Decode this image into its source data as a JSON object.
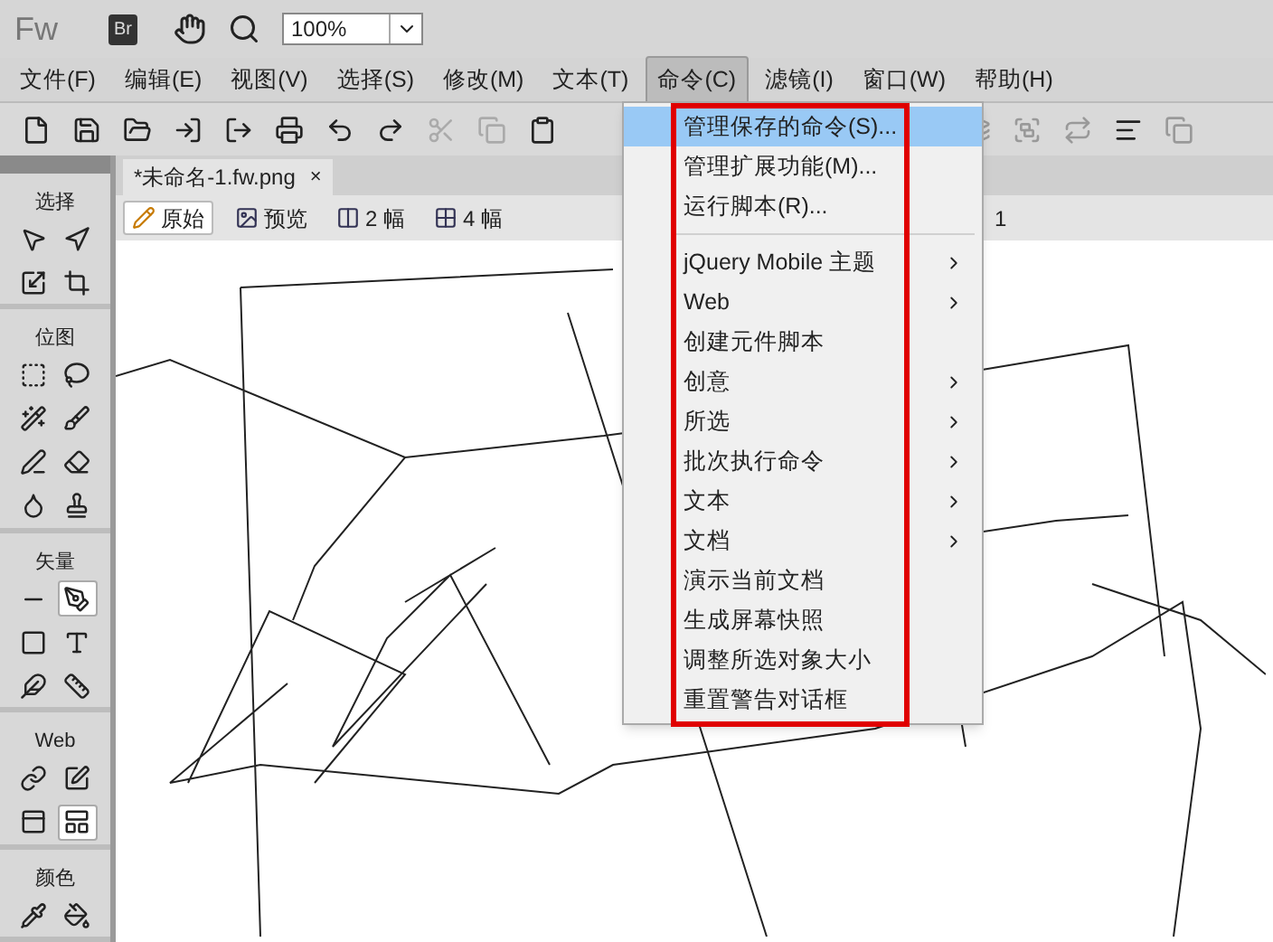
{
  "app": {
    "logo": "Fw",
    "bridge_badge": "Br",
    "zoom": {
      "value": "100%"
    }
  },
  "menu_bar": [
    {
      "label": "文件(F)",
      "selected": false
    },
    {
      "label": "编辑(E)",
      "selected": false
    },
    {
      "label": "视图(V)",
      "selected": false
    },
    {
      "label": "选择(S)",
      "selected": false
    },
    {
      "label": "修改(M)",
      "selected": false
    },
    {
      "label": "文本(T)",
      "selected": false
    },
    {
      "label": "命令(C)",
      "selected": true
    },
    {
      "label": "滤镜(I)",
      "selected": false
    },
    {
      "label": "窗口(W)",
      "selected": false
    },
    {
      "label": "帮助(H)",
      "selected": false
    }
  ],
  "document_tab": {
    "label": "*未命名-1.fw.png",
    "close": "×"
  },
  "view_bar": {
    "modes": [
      {
        "label": "原始",
        "selected": true
      },
      {
        "label": "预览",
        "selected": false
      },
      {
        "label": "2 幅",
        "selected": false
      },
      {
        "label": "4 幅",
        "selected": false
      }
    ],
    "extra": "1"
  },
  "tools_panel": {
    "sections": [
      {
        "title": "选择",
        "tools": [
          {
            "selected": false
          },
          {
            "selected": false
          },
          {
            "selected": false
          },
          {
            "selected": false
          }
        ]
      },
      {
        "title": "位图",
        "tools": [
          {
            "selected": false
          },
          {
            "selected": false
          },
          {
            "selected": false
          },
          {
            "selected": false
          },
          {
            "selected": false
          },
          {
            "selected": false
          },
          {
            "selected": false
          },
          {
            "selected": false
          }
        ]
      },
      {
        "title": "矢量",
        "tools": [
          {
            "selected": false
          },
          {
            "selected": true
          },
          {
            "selected": false
          },
          {
            "selected": false
          },
          {
            "selected": false
          },
          {
            "selected": false
          }
        ]
      },
      {
        "title": "Web",
        "tools": [
          {
            "selected": false
          },
          {
            "selected": false
          },
          {
            "selected": false
          },
          {
            "selected": true
          }
        ]
      },
      {
        "title": "颜色",
        "tools": [
          {
            "selected": false
          },
          {
            "selected": false
          }
        ]
      }
    ]
  },
  "command_menu": {
    "highlight_frame": true,
    "items": [
      {
        "kind": "item",
        "label": "管理保存的命令(S)...",
        "selected": true,
        "submenu": false
      },
      {
        "kind": "item",
        "label": "管理扩展功能(M)...",
        "selected": false,
        "submenu": false
      },
      {
        "kind": "item",
        "label": "运行脚本(R)...",
        "selected": false,
        "submenu": false
      },
      {
        "kind": "separator"
      },
      {
        "kind": "item",
        "label": "jQuery Mobile 主题",
        "selected": false,
        "submenu": true
      },
      {
        "kind": "item",
        "label": "Web",
        "selected": false,
        "submenu": true
      },
      {
        "kind": "item",
        "label": "创建元件脚本",
        "selected": false,
        "submenu": false
      },
      {
        "kind": "item",
        "label": "创意",
        "selected": false,
        "submenu": true
      },
      {
        "kind": "item",
        "label": "所选",
        "selected": false,
        "submenu": true
      },
      {
        "kind": "item",
        "label": "批次执行命令",
        "selected": false,
        "submenu": true
      },
      {
        "kind": "item",
        "label": "文本",
        "selected": false,
        "submenu": true
      },
      {
        "kind": "item",
        "label": "文档",
        "selected": false,
        "submenu": true
      },
      {
        "kind": "item",
        "label": "演示当前文档",
        "selected": false,
        "submenu": false
      },
      {
        "kind": "item",
        "label": "生成屏幕快照",
        "selected": false,
        "submenu": false
      },
      {
        "kind": "item",
        "label": "调整所选对象大小",
        "selected": false,
        "submenu": false
      },
      {
        "kind": "item",
        "label": "重置警告对话框",
        "selected": false,
        "submenu": false
      }
    ]
  }
}
